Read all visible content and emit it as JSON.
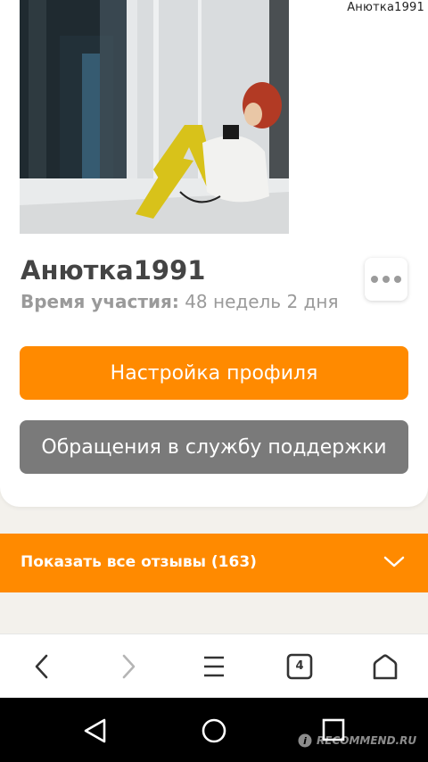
{
  "corner_username": "Анютка1991",
  "profile": {
    "username": "Анютка1991",
    "membership_label": "Время участия:",
    "membership_value": "48 недель 2 дня"
  },
  "buttons": {
    "settings_label": "Настройка профиля",
    "support_label": "Обращения в службу поддержки"
  },
  "reviews": {
    "label": "Показать все отзывы (163)"
  },
  "browser": {
    "tab_count": "4",
    "icons": [
      "back-icon",
      "forward-icon",
      "menu-icon",
      "tabs-icon",
      "home-icon"
    ]
  },
  "android_nav": {
    "icons": [
      "android-back-icon",
      "android-home-icon",
      "android-recents-icon"
    ]
  },
  "watermark": "RECOMMEND.RU",
  "colors": {
    "accent": "#ff8a00",
    "secondary_button": "#7a7a7a",
    "page_background": "#f3f1ec"
  }
}
